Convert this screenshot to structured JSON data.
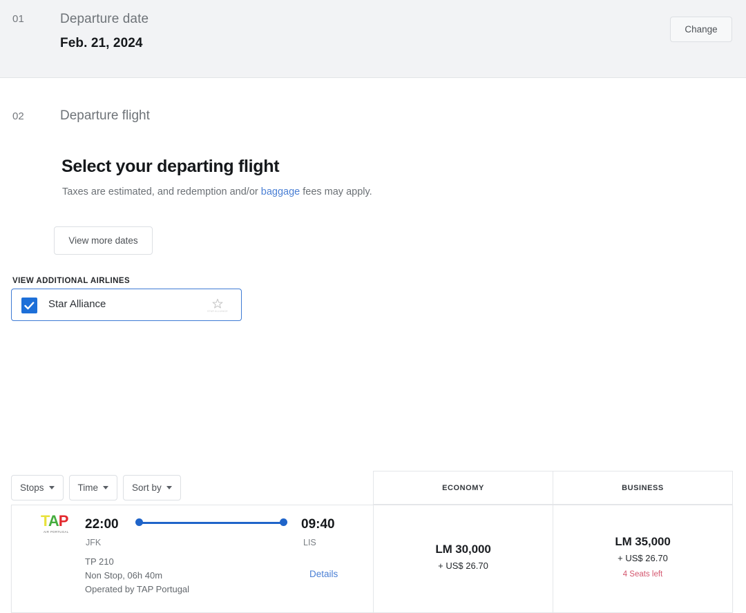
{
  "step1": {
    "number": "01",
    "label": "Departure date",
    "value": "Feb. 21, 2024",
    "change_button": "Change"
  },
  "step2": {
    "number": "02",
    "label": "Departure flight",
    "headline": "Select your departing flight",
    "subline_before": "Taxes are estimated, and redemption and/or ",
    "subline_link": "baggage",
    "subline_after": " fees may apply.",
    "view_more_dates_button": "View more dates"
  },
  "airlines": {
    "section_title": "VIEW ADDITIONAL AIRLINES",
    "alliance_name": "Star Alliance",
    "alliance_checked": true,
    "alliance_logo_text": "STAR ALLIANCE"
  },
  "filters": [
    {
      "label": "Stops"
    },
    {
      "label": "Time"
    },
    {
      "label": "Sort by"
    }
  ],
  "results": {
    "columns": [
      "ECONOMY",
      "BUSINESS"
    ],
    "rows": [
      {
        "airline_logo": "tap-portugal-logo",
        "airline_logo_text": "TAP",
        "airline_logo_sub": "AIR PORTUGAL",
        "departure_time": "22:00",
        "departure_code": "JFK",
        "arrival_time": "09:40",
        "arrival_code": "LIS",
        "flight_number": "TP 210",
        "stops_duration": "Non Stop, 06h 40m",
        "operated_by": "Operated by TAP Portugal",
        "details_link": "Details",
        "fares": [
          {
            "cabin": "ECONOMY",
            "miles": "LM 30,000",
            "taxes": "+ US$ 26.70",
            "seats_left": ""
          },
          {
            "cabin": "BUSINESS",
            "miles": "LM 35,000",
            "taxes": "+ US$ 26.70",
            "seats_left": "4 Seats left"
          }
        ]
      }
    ]
  },
  "colors": {
    "accent_blue": "#1f64c9",
    "link_blue": "#4a7fd4",
    "seats_red": "#d4566e",
    "header_bg": "#f2f3f5"
  }
}
